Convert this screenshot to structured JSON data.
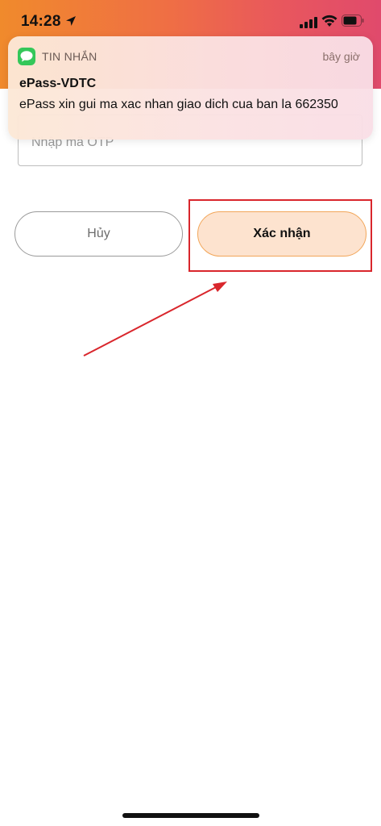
{
  "status_bar": {
    "time": "14:28",
    "icons": [
      "location-arrow-icon",
      "cellular-signal-icon",
      "wifi-icon",
      "battery-icon"
    ]
  },
  "notification": {
    "app_icon": "messages-icon",
    "app_name": "TIN NHẮN",
    "time": "bây giờ",
    "sender": "ePass-VDTC",
    "body": "ePass xin gui ma xac nhan giao dich cua ban la 662350"
  },
  "otp_input": {
    "placeholder": "Nhập mã OTP",
    "value": ""
  },
  "buttons": {
    "cancel_label": "Hủy",
    "confirm_label": "Xác nhận"
  },
  "colors": {
    "header_start": "#f08a2c",
    "header_end": "#e04a6c",
    "confirm_fill": "#fde3cf",
    "confirm_border": "#f2a65a",
    "annotation_red": "#d9262c"
  }
}
